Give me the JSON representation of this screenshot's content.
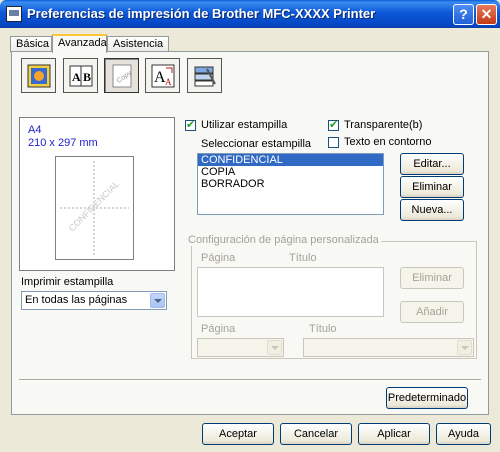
{
  "window": {
    "title": "Preferencias de impresión de Brother MFC-XXXX Printer",
    "help_label": "?",
    "close_label": "✕"
  },
  "tabs": [
    {
      "label": "Básica"
    },
    {
      "label": "Avanzada"
    },
    {
      "label": "Asistencia"
    }
  ],
  "toolbar_icons": [
    "quality-icon",
    "duplex-icon",
    "watermark-icon",
    "scaling-icon",
    "device-options-icon"
  ],
  "preview": {
    "paper": "A4",
    "size": "210 x 297 mm",
    "watermark_text": "CONFIDENCIAL"
  },
  "print_watermark": {
    "label": "Imprimir estampilla",
    "selected": "En todas las páginas"
  },
  "use_watermark": {
    "label": "Utilizar estampilla",
    "checked": true
  },
  "transparent": {
    "label": "Transparente(b)",
    "checked": true
  },
  "outline_text": {
    "label": "Texto en contorno",
    "checked": false
  },
  "select_watermark": {
    "label": "Seleccionar estampilla",
    "items": [
      "CONFIDENCIAL",
      "COPIA",
      "BORRADOR"
    ],
    "selected_index": 0
  },
  "buttons": {
    "edit": "Editar...",
    "delete": "Eliminar",
    "new": "Nueva..."
  },
  "custom_page": {
    "title": "Configuración de página personalizada",
    "col_page": "Página",
    "col_title": "Título",
    "delete": "Eliminar",
    "add": "Añadir",
    "page_label": "Página",
    "title_label": "Título"
  },
  "default_button": "Predeterminado",
  "footer": {
    "ok": "Aceptar",
    "cancel": "Cancelar",
    "apply": "Aplicar",
    "help": "Ayuda"
  },
  "colors": {
    "title_bar": "#0a5fd8",
    "selection": "#316ac5",
    "preview_text": "#2222cc"
  }
}
